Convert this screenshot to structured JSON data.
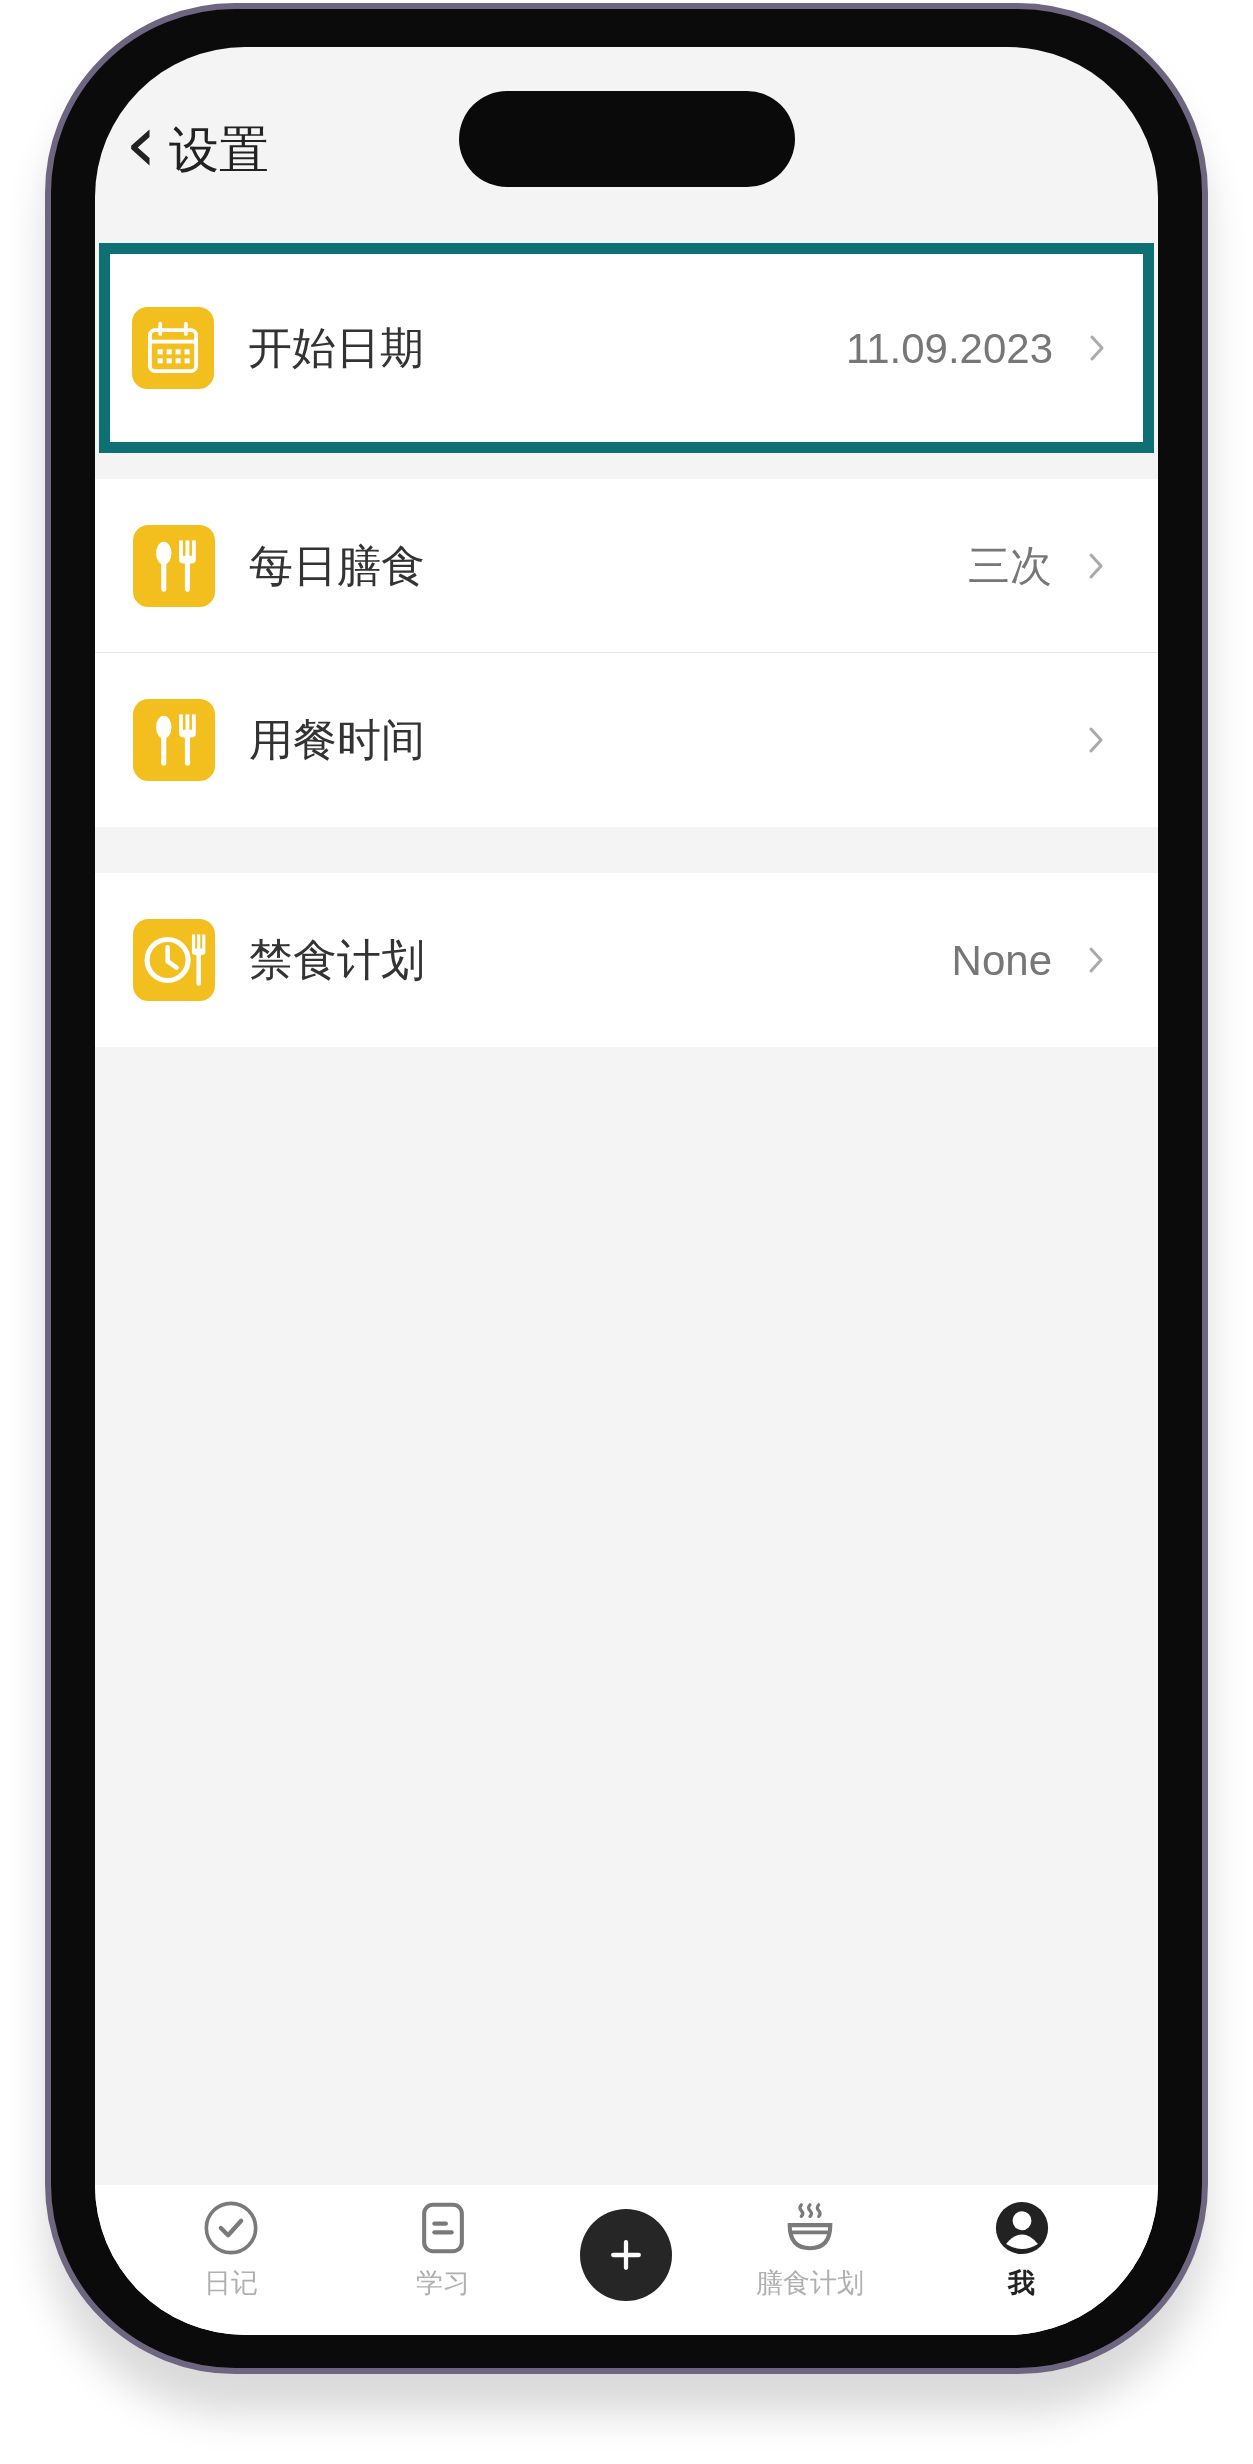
{
  "header": {
    "back_icon": "‹",
    "title": "设置"
  },
  "groups": [
    {
      "rows": [
        {
          "kind": "calendar",
          "label": "开始日期",
          "value": "11.09.2023",
          "highlighted": true
        }
      ]
    },
    {
      "rows": [
        {
          "kind": "utensils",
          "label": "每日膳食",
          "value": "三次",
          "highlighted": false
        },
        {
          "kind": "utensils",
          "label": "用餐时间",
          "highlighted": false
        }
      ]
    },
    {
      "rows": [
        {
          "kind": "clock",
          "label": "禁食计划",
          "value": "None",
          "highlighted": false
        }
      ]
    }
  ],
  "tab_bar": [
    {
      "kind": "check",
      "label": "日记",
      "selected": false
    },
    {
      "kind": "note",
      "label": "学习",
      "selected": false
    },
    {
      "kind": "plus"
    },
    {
      "kind": "bowl",
      "label": "膳食计划",
      "selected": false
    },
    {
      "kind": "user",
      "label": "我",
      "selected": true
    }
  ]
}
